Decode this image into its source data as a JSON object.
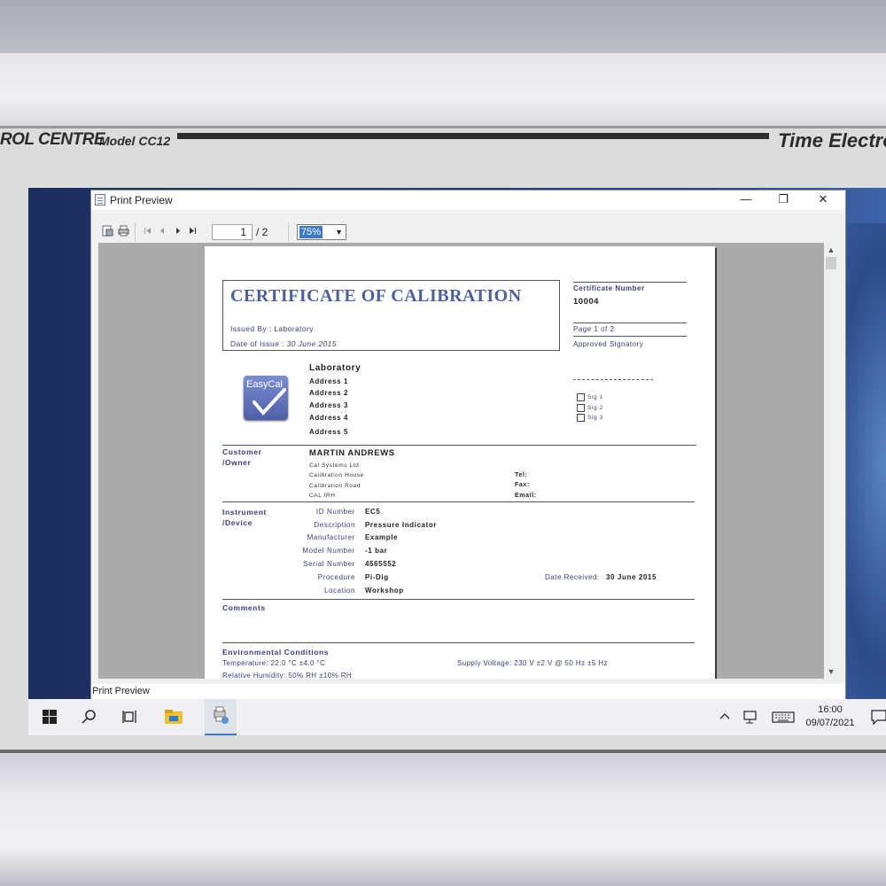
{
  "device": {
    "title_left": "ROL CENTRE",
    "model": "Model CC12",
    "brand": "Time Electro"
  },
  "window": {
    "title": "Print Preview",
    "controls": {
      "minimize": "—",
      "maximize": "❐",
      "close": "✕"
    },
    "toolbar": {
      "page_current": "1",
      "page_total": "/ 2",
      "zoom": "75%"
    },
    "status": "Print Preview"
  },
  "certificate": {
    "title": "CERTIFICATE OF CALIBRATION",
    "issued_by": "Issued By : Laboratory",
    "date_issue_label": "Date of Issue : ",
    "date_issue_value": "30 June 2015",
    "cert_number_label": "Certificate Number",
    "cert_number": "10004",
    "page_of": "Page 1 of 2",
    "approved": "Approved Signatory",
    "logo_text": "EasyCal",
    "lab": {
      "name": "Laboratory",
      "address": [
        "Address 1",
        "Address 2",
        "Address 3",
        "Address 4",
        "Address 5"
      ]
    },
    "signatures": [
      "Sig 1",
      "Sig 2",
      "Sig 3"
    ],
    "customer": {
      "label1": "Customer",
      "label2": "/Owner",
      "name": "MARTIN ANDREWS",
      "lines": [
        "Cal Systems Ltd",
        "Calibration House",
        "Calibration Road",
        "CAL IRH"
      ],
      "tel": "Tel:",
      "fax": "Fax:",
      "email": "Email:"
    },
    "instrument": {
      "label1": "Instrument",
      "label2": "/Device",
      "fields": [
        {
          "label": "ID Number",
          "value": "EC5"
        },
        {
          "label": "Description",
          "value": "Pressure Indicator"
        },
        {
          "label": "Manufacturer",
          "value": "Example"
        },
        {
          "label": "Model Number",
          "value": "-1 bar"
        },
        {
          "label": "Serial Number",
          "value": "4565552"
        },
        {
          "label": "Procedure",
          "value": "Pi-Dig"
        },
        {
          "label": "Location",
          "value": "Workshop"
        }
      ],
      "date_received_label": "Date Received:",
      "date_received": "30 June 2015"
    },
    "comments_label": "Comments",
    "env": {
      "label": "Environmental Conditions",
      "temperature": "Temperature: 22.0 °C ±4.0 °C",
      "humidity": "Relative Humidity: 50% RH  ±10% RH",
      "supply": "Supply Voltage: 230 V ±2 V @ 50 Hz ±5 Hz"
    }
  },
  "taskbar": {
    "time": "16:00",
    "date": "09/07/2021"
  }
}
